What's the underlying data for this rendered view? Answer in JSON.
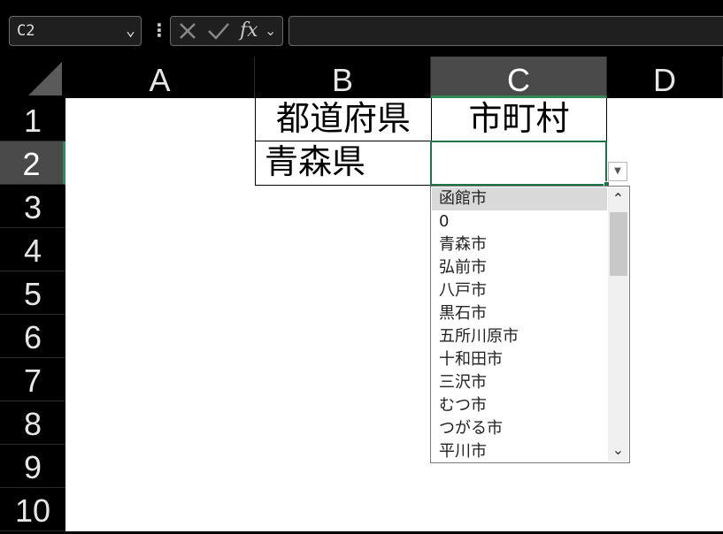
{
  "formula_bar": {
    "name_box": "C2",
    "function_label": "fx",
    "formula_value": ""
  },
  "columns": [
    "A",
    "B",
    "C",
    "D"
  ],
  "rows": [
    "1",
    "2",
    "3",
    "4",
    "5",
    "6",
    "7",
    "8",
    "9",
    "10"
  ],
  "selected_cell": "C2",
  "cells": {
    "B1": "都道府県",
    "C1": "市町村",
    "B2": "青森県",
    "C2": ""
  },
  "dropdown": {
    "items": [
      "函館市",
      "0",
      "青森市",
      "弘前市",
      "八戸市",
      "黒石市",
      "五所川原市",
      "十和田市",
      "三沢市",
      "むつ市",
      "つがる市",
      "平川市"
    ],
    "highlighted_index": 0
  },
  "colors": {
    "accent_green": "#217346",
    "header_bg": "#000000",
    "selected_header_bg": "#4a4a4a"
  }
}
